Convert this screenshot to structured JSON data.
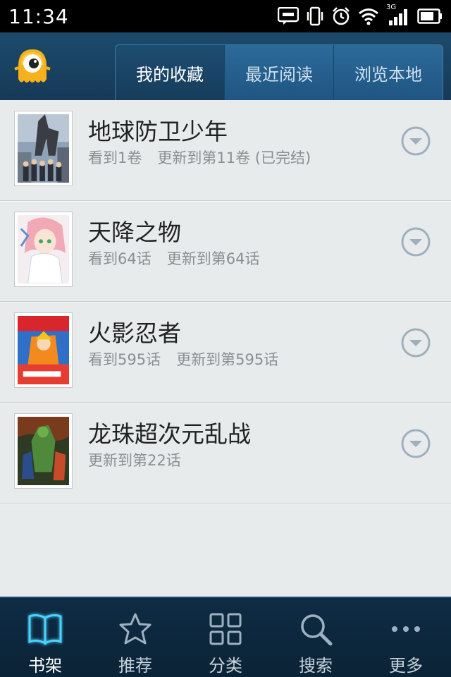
{
  "status_bar": {
    "time": "11:34",
    "icons": [
      "message-icon",
      "vibrate-icon",
      "alarm-icon",
      "wifi-icon",
      "signal-3g-icon",
      "battery-icon"
    ],
    "network_label": "3G"
  },
  "header": {
    "logo_icon": "mascot-logo-icon",
    "tabs": [
      {
        "label": "我的收藏",
        "active": true
      },
      {
        "label": "最近阅读",
        "active": false
      },
      {
        "label": "浏览本地",
        "active": false
      }
    ]
  },
  "comics": [
    {
      "title": "地球防卫少年",
      "read": "看到1卷",
      "updated": "更新到第11卷 (已完结)"
    },
    {
      "title": "天降之物",
      "read": "看到64话",
      "updated": "更新到第64话"
    },
    {
      "title": "火影忍者",
      "read": "看到595话",
      "updated": "更新到第595话"
    },
    {
      "title": "龙珠超次元乱战",
      "read": "",
      "updated": "更新到第22话"
    }
  ],
  "bottom_nav": [
    {
      "label": "书架",
      "icon": "book-icon",
      "active": true
    },
    {
      "label": "推荐",
      "icon": "star-icon",
      "active": false
    },
    {
      "label": "分类",
      "icon": "grid-icon",
      "active": false
    },
    {
      "label": "搜索",
      "icon": "search-icon",
      "active": false
    },
    {
      "label": "更多",
      "icon": "more-icon",
      "active": false
    }
  ],
  "colors": {
    "header_bg": "#1d4a6c",
    "tab_active_bg": "#163c5a",
    "list_bg": "#e8ebec",
    "nav_bg": "#0e2c44",
    "accent_glow": "#4ad3ff"
  }
}
